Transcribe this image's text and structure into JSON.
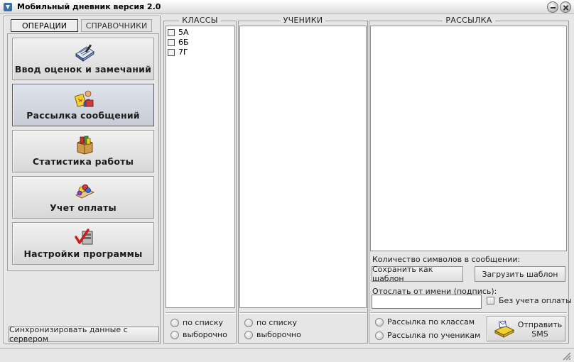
{
  "window": {
    "title": "Мобильный дневник версия 2.0",
    "icon": "app-logo-icon",
    "controls": [
      "minimize-icon",
      "close-icon"
    ]
  },
  "tabs": {
    "operations": "ОПЕРАЦИИ",
    "references": "СПРАВОЧНИКИ"
  },
  "menu": [
    {
      "label": "Ввод оценок и замечаний",
      "icon": "grades-book-icon"
    },
    {
      "label": "Рассылка сообщений",
      "icon": "messaging-icon"
    },
    {
      "label": "Статистика работы",
      "icon": "statistics-box-icon"
    },
    {
      "label": "Учет оплаты",
      "icon": "payment-icon"
    },
    {
      "label": "Настройки программы",
      "icon": "settings-icon"
    }
  ],
  "sync_button": "Синхронизировать данные с сервером",
  "classes": {
    "title": "КЛАССЫ",
    "items": [
      "5А",
      "6Б",
      "7Г"
    ],
    "radio_list": "по  списку",
    "radio_selective": "выборочно"
  },
  "students": {
    "title": "УЧЕНИКИ",
    "radio_list": "по  списку",
    "radio_selective": "выборочно"
  },
  "mailing": {
    "title": "РАССЫЛКА",
    "char_count_label": "Количество символов в сообщении:",
    "save_template": "Сохранить как шаблон",
    "load_template": "Загрузить шаблон",
    "sender_label": "Отослать от имени (подпись):",
    "sender_value": "",
    "no_payment_label": "Без учета оплаты",
    "by_classes": "Рассылка по  классам",
    "by_students": "Рассылка по ученикам",
    "send_line1": "Отправить",
    "send_line2": "SMS"
  }
}
